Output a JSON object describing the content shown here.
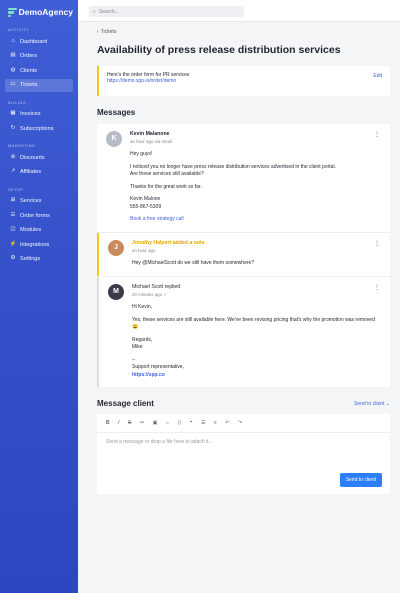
{
  "app": {
    "name": "DemoAgency"
  },
  "search": {
    "placeholder": "Search..."
  },
  "sidebar": {
    "sections": [
      {
        "title": "Activity",
        "items": [
          "Dashboard",
          "Orders",
          "Clients",
          "Tickets"
        ]
      },
      {
        "title": "Billing",
        "items": [
          "Invoices",
          "Subscriptions"
        ]
      },
      {
        "title": "Marketing",
        "items": [
          "Discounts",
          "Affiliates"
        ]
      },
      {
        "title": "Setup",
        "items": [
          "Services",
          "Order forms",
          "Modules",
          "Integrations",
          "Settings"
        ]
      }
    ],
    "active": "Tickets"
  },
  "page": {
    "back": "Tickets",
    "title": "Availability of press release distribution services"
  },
  "intro": {
    "text": "Here's the order form for PR services",
    "link": "https://demo.spp.io/order/demo",
    "edit": "Edit"
  },
  "messages_title": "Messages",
  "messages": [
    {
      "author": "Kevin Malanone",
      "meta": "an hour ago via email",
      "lines": [
        "Hey guys!",
        "",
        "I noticed you no longer have press release distribution services advertised in the client portal.",
        "Are these services still available?",
        "",
        "Thanks for the great work so far.",
        "",
        "Kevin Malone",
        "555-867-5309",
        "",
        "Book a free strategy call"
      ]
    },
    {
      "author": "Jonathy Halpert added a note",
      "meta": "an hour ago",
      "lines": [
        "Hey @MichaelScott do we still have them somewhere?"
      ]
    },
    {
      "author": "Michael Scott replied",
      "meta": "20 minutes ago",
      "lines": [
        "Hi Kevin,",
        "",
        "Yes, these services are still available here. We've been revising pricing that's why the promotion was removed 😀",
        "",
        "Regards,",
        "Mike",
        "",
        "--",
        "Support representative,",
        "https://spp.co"
      ]
    }
  ],
  "composer": {
    "title": "Message client",
    "send_to": "Send to client",
    "placeholder": "Send a message or drop a file here to attach it...",
    "send": "Send to client"
  },
  "colors": {
    "sidebar": "#3f5fd6",
    "accent": "#2d7ff9",
    "note": "#f5c518"
  }
}
